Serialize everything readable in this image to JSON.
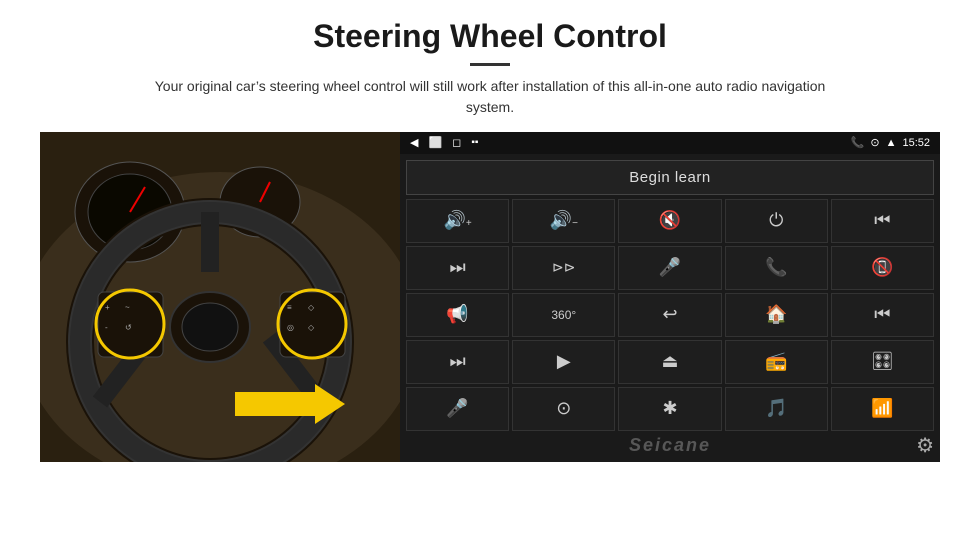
{
  "header": {
    "title": "Steering Wheel Control",
    "subtitle": "Your original car’s steering wheel control will still work after installation of this all-in-one auto radio navigation system."
  },
  "android": {
    "statusbar": {
      "time": "15:52",
      "icons_left": [
        "◄",
        "□",
        "□"
      ]
    },
    "begin_learn_label": "Begin learn",
    "icon_grid": [
      [
        "🔊+",
        "🔊-",
        "🔇",
        "⏻",
        "⏮"
      ],
      [
        "⏭",
        "⏭",
        "🎤",
        "📞",
        "📵"
      ],
      [
        "📢",
        "360°",
        "↩",
        "🏠",
        "⏮"
      ],
      [
        "⏭",
        "▶",
        "⏏",
        "📻",
        "🎛"
      ],
      [
        "🎤",
        "⊙",
        "✱",
        "🎵",
        "📶"
      ]
    ],
    "seicane_watermark": "Seicane",
    "gear_label": "⚙"
  }
}
